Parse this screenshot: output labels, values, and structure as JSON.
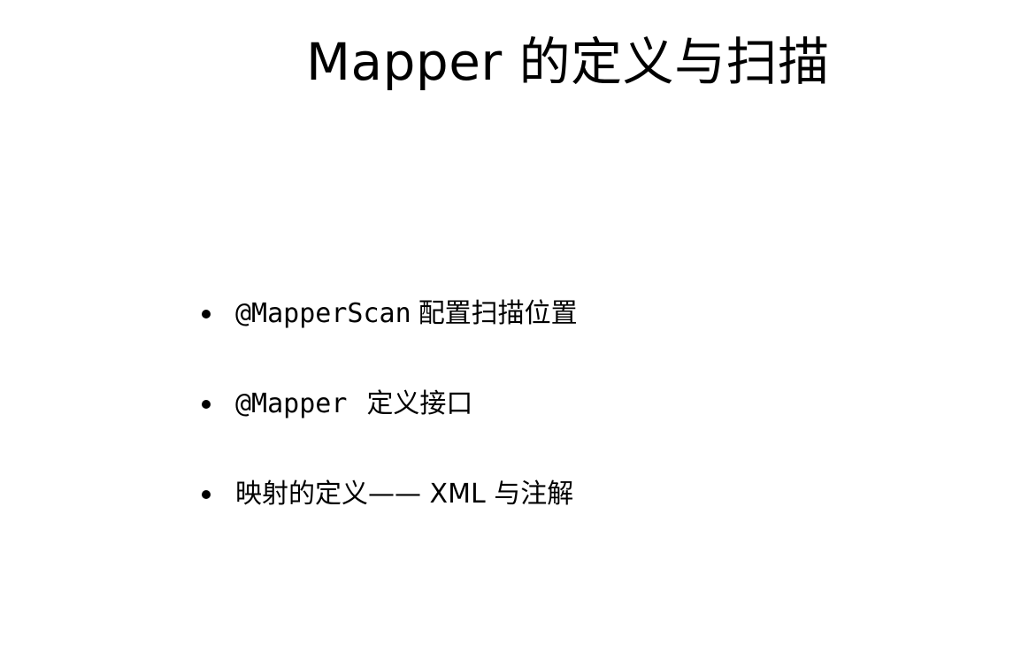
{
  "slide": {
    "title": "Mapper 的定义与扫描",
    "bullets": [
      {
        "code": "@MapperScan",
        "text": "配置扫描位置"
      },
      {
        "code": "@Mapper",
        "text": "定义接口"
      },
      {
        "code": "",
        "text": "映射的定义—— XML 与注解"
      }
    ]
  }
}
